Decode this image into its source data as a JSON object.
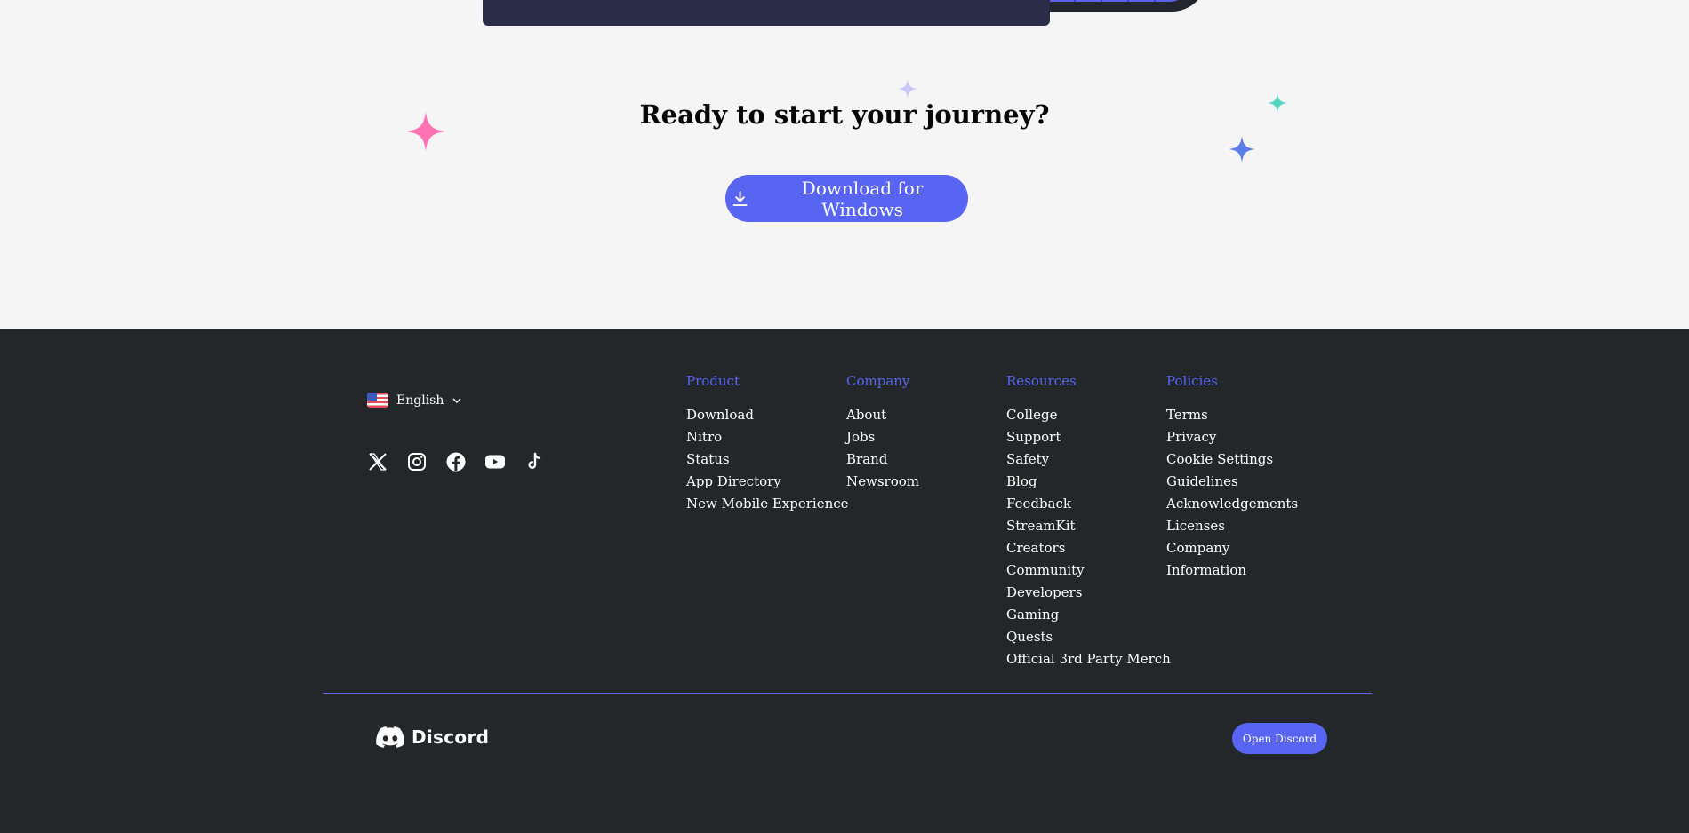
{
  "cta": {
    "title": "Ready to start your journey?",
    "download_label": "Download for Windows"
  },
  "footer": {
    "language": "English",
    "social_icons": [
      "x-icon",
      "instagram-icon",
      "facebook-icon",
      "youtube-icon",
      "tiktok-icon"
    ],
    "columns": [
      {
        "heading": "Product",
        "links": [
          "Download",
          "Nitro",
          "Status",
          "App Directory",
          "New Mobile Experience"
        ]
      },
      {
        "heading": "Company",
        "links": [
          "About",
          "Jobs",
          "Brand",
          "Newsroom"
        ]
      },
      {
        "heading": "Resources",
        "links": [
          "College",
          "Support",
          "Safety",
          "Blog",
          "Feedback",
          "StreamKit",
          "Creators",
          "Community",
          "Developers",
          "Gaming",
          "Quests",
          "Official 3rd Party Merch"
        ]
      },
      {
        "heading": "Policies",
        "links": [
          "Terms",
          "Privacy",
          "Cookie Settings",
          "Guidelines",
          "Acknowledgements",
          "Licenses",
          "Company",
          "Information"
        ]
      }
    ],
    "brand_name": "Discord",
    "open_button": "Open Discord"
  },
  "colors": {
    "accent": "#5865f2",
    "footer_bg": "#23272a",
    "page_bg": "#f5f5f5"
  }
}
